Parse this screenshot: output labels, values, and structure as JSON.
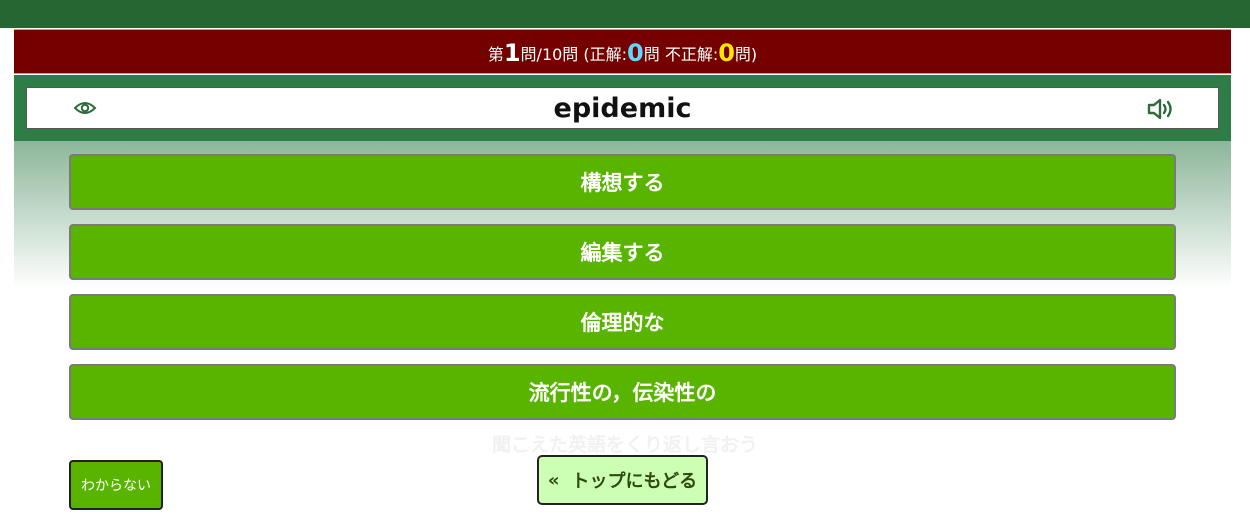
{
  "header": {
    "prefix": "第",
    "current": "1",
    "total_text": "問/10問 (正解:",
    "correct": "0",
    "mid_text": "問 不正解:",
    "incorrect": "0",
    "suffix": "問)"
  },
  "question": {
    "word": "epidemic",
    "show_icon": "eye-icon",
    "audio_icon": "speaker-icon"
  },
  "choices": [
    {
      "label": "構想する"
    },
    {
      "label": "編集する"
    },
    {
      "label": "倫理的な"
    },
    {
      "label": "流行性の，伝染性の"
    }
  ],
  "hint": "聞こえた英語をくり返し言おう",
  "buttons": {
    "dont_know": "わからない",
    "back_arrow": "«",
    "back_top": "トップにもどる"
  },
  "colors": {
    "topbar": "#266632",
    "status_bg": "#740000",
    "choice_bg": "#59b400",
    "correct_count": "#5fd7ff",
    "incorrect_count": "#ffe600",
    "back_button_bg": "#ccffb3"
  }
}
